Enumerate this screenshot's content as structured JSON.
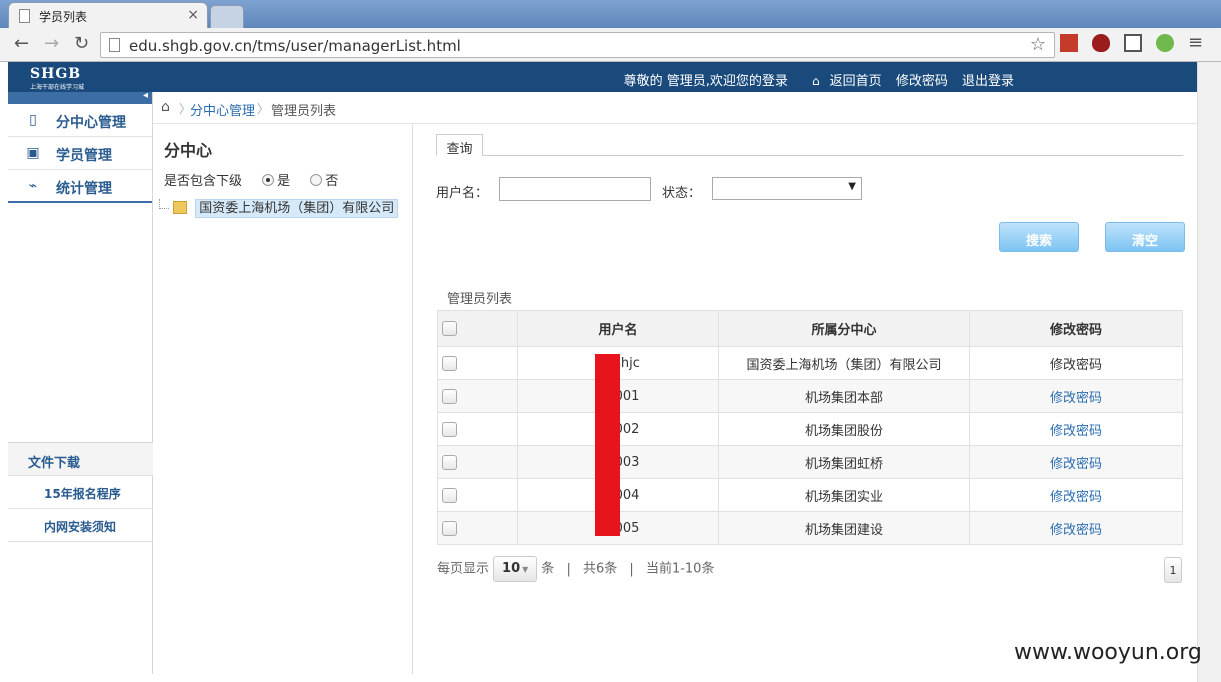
{
  "browser": {
    "tab_title": "学员列表",
    "url": "edu.shgb.gov.cn/tms/user/managerList.html"
  },
  "header": {
    "logo_text": "SHGB",
    "logo_sub": "上海干部在线学习城",
    "welcome": "尊敬的 管理员,欢迎您的登录",
    "home_link": "返回首页",
    "change_pwd_link": "修改密码",
    "logout_link": "退出登录"
  },
  "sidebar": {
    "items": [
      {
        "label": "分中心管理",
        "icon": "document-icon"
      },
      {
        "label": "学员管理",
        "icon": "users-icon"
      },
      {
        "label": "统计管理",
        "icon": "chart-icon"
      }
    ],
    "downloads_title": "文件下载",
    "downloads": [
      "15年报名程序",
      "内网安装须知"
    ]
  },
  "breadcrumb": {
    "items": [
      "分中心管理",
      "管理员列表"
    ]
  },
  "tree": {
    "title": "分中心",
    "include_label": "是否包含下级",
    "yes": "是",
    "no": "否",
    "selected": "是",
    "root_node": "国资委上海机场（集团）有限公司"
  },
  "query": {
    "tab_label": "查询",
    "username_label": "用户名：",
    "username_value": "",
    "status_label": "状态：",
    "status_value": "",
    "search_button": "搜索",
    "clear_button": "清空"
  },
  "list": {
    "title": "管理员列表",
    "columns": [
      "用户名",
      "所属分中心",
      "修改密码"
    ],
    "rows": [
      {
        "user": "shjc",
        "center": "国资委上海机场（集团）有限公司",
        "action": "修改密码"
      },
      {
        "user": "001",
        "center": "机场集团本部",
        "action": "修改密码"
      },
      {
        "user": "002",
        "center": "机场集团股份",
        "action": "修改密码"
      },
      {
        "user": "003",
        "center": "机场集团虹桥",
        "action": "修改密码"
      },
      {
        "user": "004",
        "center": "机场集团实业",
        "action": "修改密码"
      },
      {
        "user": "005",
        "center": "机场集团建设",
        "action": "修改密码"
      }
    ]
  },
  "pager": {
    "per_page_label": "每页显示",
    "per_page_value": "10",
    "unit": "条",
    "total": "共6条",
    "current": "当前1-10条",
    "page": "1"
  },
  "watermark": "www.wooyun.org",
  "colors": {
    "header_bg": "#1a4a7c",
    "link": "#2a6cb0",
    "redaction": "#e8141b",
    "button": "#7cc4f2"
  }
}
